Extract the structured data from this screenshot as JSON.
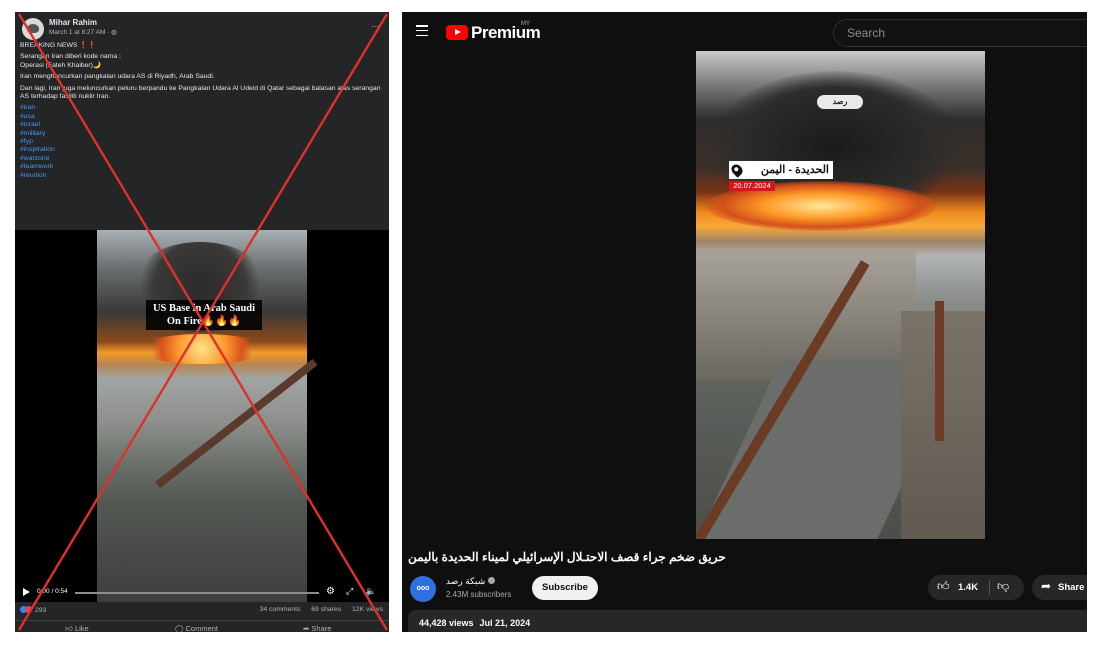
{
  "facebook_post": {
    "author": "Mihar Rahim",
    "timestamp": "March 1 at 8:27 AM · ",
    "more_icon": "...",
    "paragraphs": [
      "BREAKING NEWS ❗❗",
      "Serangan Iran diberi kode nama ;\nOperasi (Fateh Khaiber)🌙",
      "Iran menghancurkan pangkalan udara AS di Riyadh, Arab Saudi.",
      "Dan lagi, Iran juga meluncurkan peluru berpandu ke Pangkalan Udara Al Udeid di Qatar sebagai balasan atas serangan AS terhadap fasiliti nuklir Iran."
    ],
    "hashtags": [
      "#iran",
      "#usa",
      "#israel",
      "#military",
      "#fyp",
      "#inspiration",
      "#warzone",
      "#teamwork",
      "#reunion"
    ],
    "video_caption": "US Base in Arab Saudi On Fire🔥🔥🔥",
    "video_time": "0:00 / 0:54",
    "reactions_count": "293",
    "comments": "34 comments",
    "shares": "69 shares",
    "views": "12K views",
    "actions": {
      "like": "Like",
      "comment": "Comment",
      "share": "Share"
    },
    "cross_color": "#e0302a"
  },
  "youtube": {
    "brand": "Premium",
    "brand_region": "MY",
    "search_placeholder": "Search",
    "video_overlay": {
      "watermark": "ﺭﺻﺪ",
      "location": "الحديدة - اليمن",
      "date": "20.07.2024"
    },
    "title": "حريق ضخم جراء قصف الاحتـلال الإسرائيلي لميناء الحديدة باليمن",
    "channel": {
      "name": "شبكة رصد",
      "avatar_text": "ooo",
      "subscribers": "2.43M subscribers"
    },
    "subscribe_label": "Subscribe",
    "likes": "1.4K",
    "share_label": "Share",
    "views": "44,428 views",
    "upload_date": "Jul 21, 2024",
    "accent_color": "#ff0000"
  }
}
